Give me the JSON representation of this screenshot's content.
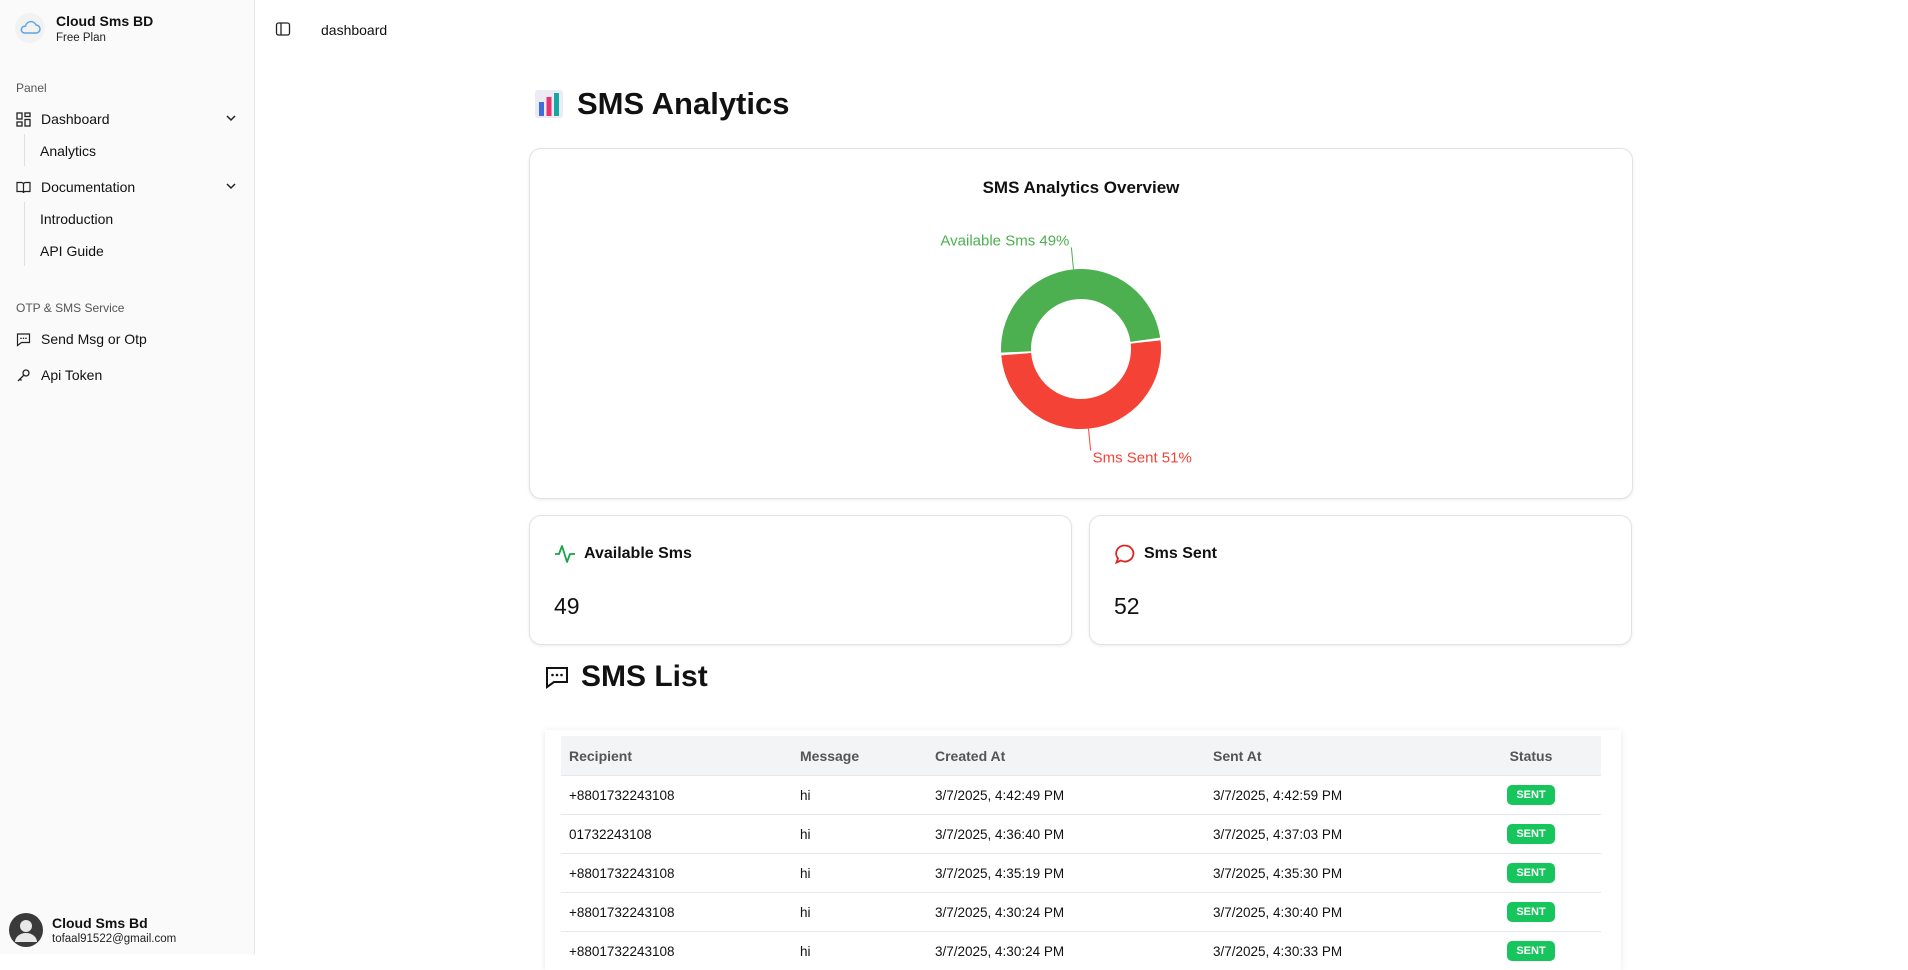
{
  "sidebar": {
    "brand_name": "Cloud Sms BD",
    "brand_plan": "Free Plan",
    "panel_label": "Panel",
    "dashboard": "Dashboard",
    "analytics": "Analytics",
    "documentation": "Documentation",
    "introduction": "Introduction",
    "api_guide": "API Guide",
    "service_label": "OTP & SMS Service",
    "send_msg": "Send Msg or Otp",
    "api_token": "Api Token",
    "user_name": "Cloud Sms Bd",
    "user_email": "tofaal91522@gmail.com"
  },
  "topbar": {
    "breadcrumb": "dashboard"
  },
  "main": {
    "title": "SMS Analytics",
    "list_title": "SMS List",
    "stats": [
      {
        "label": "Available Sms",
        "value": "49"
      },
      {
        "label": "Sms Sent",
        "value": "52"
      }
    ]
  },
  "chart_data": {
    "type": "pie",
    "title": "SMS Analytics Overview",
    "slices": [
      {
        "label": "Available Sms 49%",
        "value": 49,
        "color": "#4caf50"
      },
      {
        "label": "Sms Sent 51%",
        "value": 51,
        "color": "#f44336"
      }
    ]
  },
  "table": {
    "headers": [
      "Recipient",
      "Message",
      "Created At",
      "Sent At",
      "Status"
    ],
    "rows": [
      [
        "+8801732243108",
        "hi",
        "3/7/2025, 4:42:49 PM",
        "3/7/2025, 4:42:59 PM",
        "SENT"
      ],
      [
        "01732243108",
        "hi",
        "3/7/2025, 4:36:40 PM",
        "3/7/2025, 4:37:03 PM",
        "SENT"
      ],
      [
        "+8801732243108",
        "hi",
        "3/7/2025, 4:35:19 PM",
        "3/7/2025, 4:35:30 PM",
        "SENT"
      ],
      [
        "+8801732243108",
        "hi",
        "3/7/2025, 4:30:24 PM",
        "3/7/2025, 4:30:40 PM",
        "SENT"
      ],
      [
        "+8801732243108",
        "hi",
        "3/7/2025, 4:30:24 PM",
        "3/7/2025, 4:30:33 PM",
        "SENT"
      ]
    ]
  },
  "colors": {
    "accent_green": "#4caf50",
    "accent_red": "#f44336",
    "badge_green": "#16c55c"
  }
}
